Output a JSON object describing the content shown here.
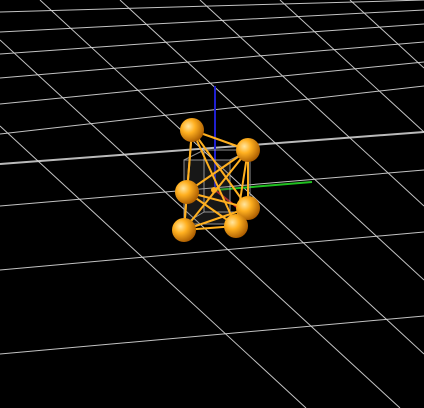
{
  "scene": {
    "background_color": "#000000",
    "grid_color": "#d9d9d9",
    "node_color": "#ffb020",
    "axis_colors": {
      "x": "#cc2020",
      "y": "#20c020",
      "z": "#2020d0"
    },
    "nodes": [
      {
        "id": "node-1"
      },
      {
        "id": "node-2"
      },
      {
        "id": "node-3"
      },
      {
        "id": "node-4"
      },
      {
        "id": "node-5"
      },
      {
        "id": "node-6"
      },
      {
        "id": "node-7"
      }
    ]
  }
}
